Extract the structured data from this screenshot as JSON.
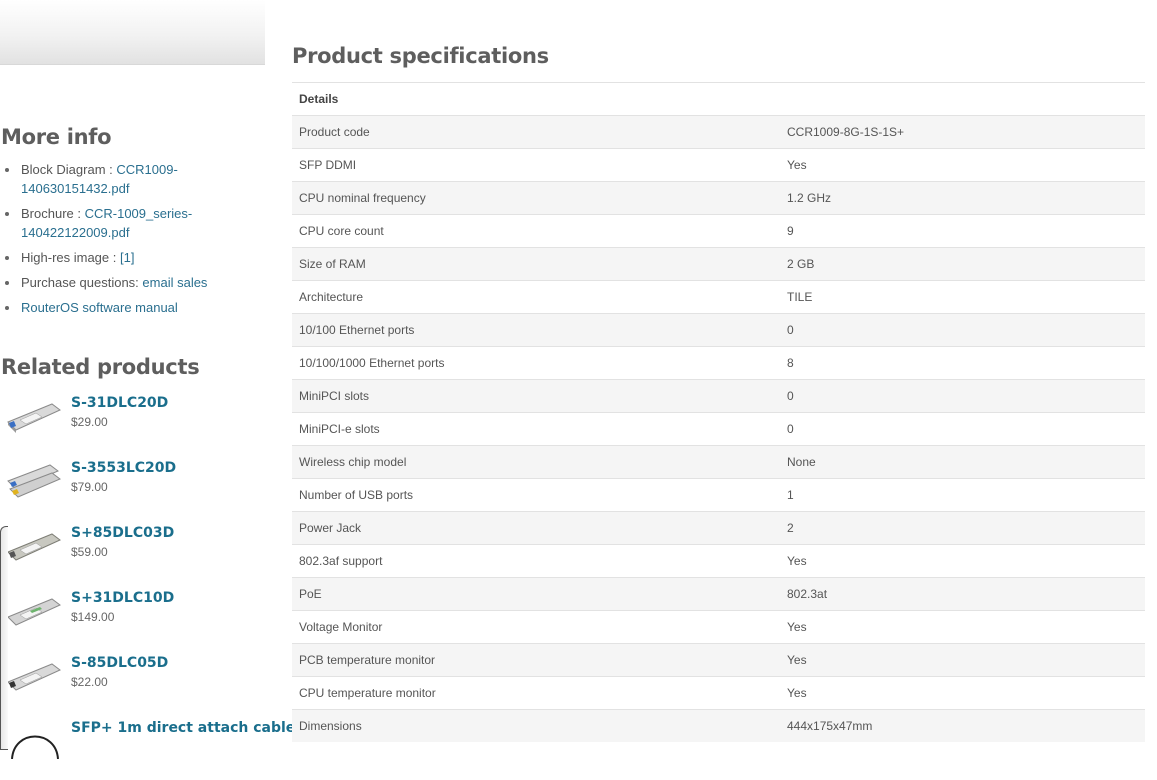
{
  "sidebar": {
    "more_info": {
      "heading": "More info",
      "items": [
        {
          "prefix": "Block Diagram : ",
          "link": "CCR1009-140630151432.pdf"
        },
        {
          "prefix": "Brochure : ",
          "link": "CCR-1009_series-140422122009.pdf"
        },
        {
          "prefix": "High-res image : ",
          "link": "[1]"
        },
        {
          "prefix": "Purchase questions: ",
          "link": "email sales"
        },
        {
          "prefix": "",
          "link": "RouterOS software manual"
        }
      ]
    },
    "related": {
      "heading": "Related products",
      "products": [
        {
          "name": "S-31DLC20D",
          "price": "$29.00"
        },
        {
          "name": "S-3553LC20D",
          "price": "$79.00"
        },
        {
          "name": "S+85DLC03D",
          "price": "$59.00"
        },
        {
          "name": "S+31DLC10D",
          "price": "$149.00"
        },
        {
          "name": "S-85DLC05D",
          "price": "$22.00"
        },
        {
          "name": "SFP+ 1m direct attach cable",
          "price": ""
        }
      ]
    }
  },
  "main": {
    "title": "Product specifications",
    "table": {
      "header": "Details",
      "rows": [
        {
          "label": "Product code",
          "value": "CCR1009-8G-1S-1S+"
        },
        {
          "label": "SFP DDMI",
          "value": "Yes"
        },
        {
          "label": "CPU nominal frequency",
          "value": "1.2 GHz"
        },
        {
          "label": "CPU core count",
          "value": "9"
        },
        {
          "label": "Size of RAM",
          "value": "2 GB"
        },
        {
          "label": "Architecture",
          "value": "TILE"
        },
        {
          "label": "10/100 Ethernet ports",
          "value": "0"
        },
        {
          "label": "10/100/1000 Ethernet ports",
          "value": "8"
        },
        {
          "label": "MiniPCI slots",
          "value": "0"
        },
        {
          "label": "MiniPCI-e slots",
          "value": "0"
        },
        {
          "label": "Wireless chip model",
          "value": "None"
        },
        {
          "label": "Number of USB ports",
          "value": "1"
        },
        {
          "label": "Power Jack",
          "value": "2"
        },
        {
          "label": "802.3af support",
          "value": "Yes"
        },
        {
          "label": "PoE",
          "value": "802.3at"
        },
        {
          "label": "Voltage Monitor",
          "value": "Yes"
        },
        {
          "label": "PCB temperature monitor",
          "value": "Yes"
        },
        {
          "label": "CPU temperature monitor",
          "value": "Yes"
        },
        {
          "label": "Dimensions",
          "value": "444x175x47mm"
        }
      ]
    }
  },
  "colors": {
    "link": "#2a6f8f",
    "product_link": "#1a6e8c",
    "heading": "#5e5e5e",
    "row_alt": "#f5f5f5"
  }
}
